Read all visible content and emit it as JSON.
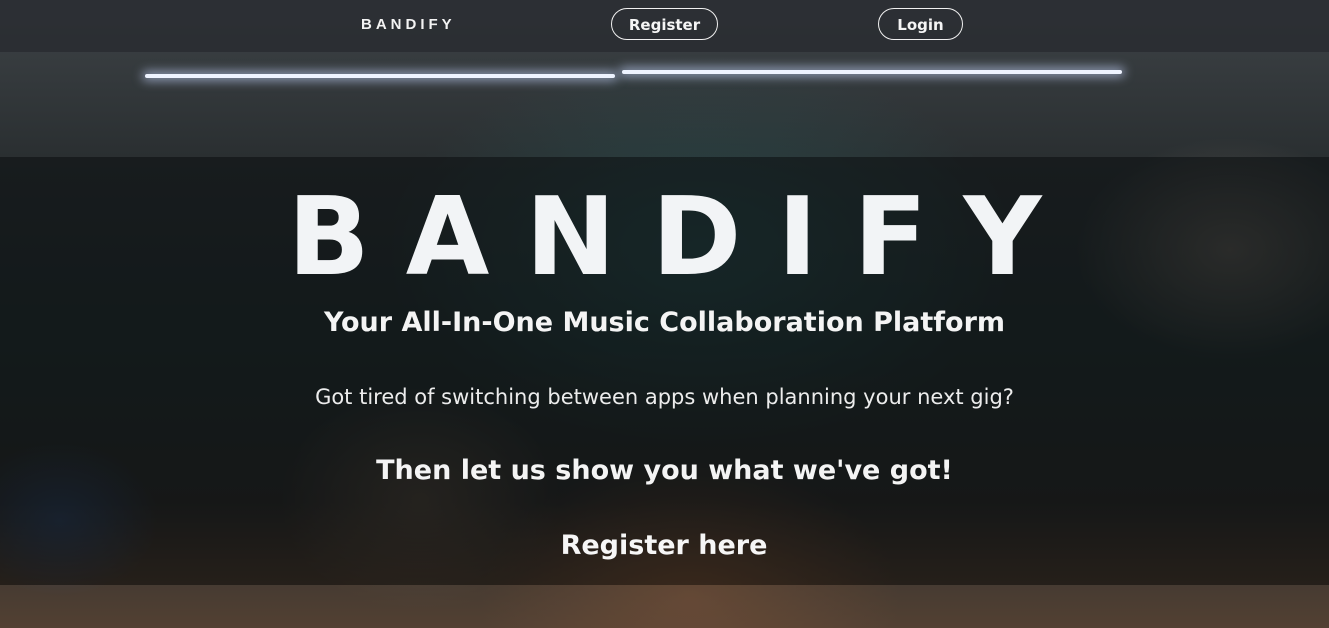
{
  "header": {
    "brand": "BANDIFY",
    "register_label": "Register",
    "login_label": "Login"
  },
  "hero": {
    "title": "BANDIFY",
    "tagline": "Your All-In-One Music Collaboration Platform",
    "question": "Got tired of switching between apps when planning your next gig?",
    "cta_text": "Then let us show you what we've got!",
    "register_link": "Register here"
  }
}
